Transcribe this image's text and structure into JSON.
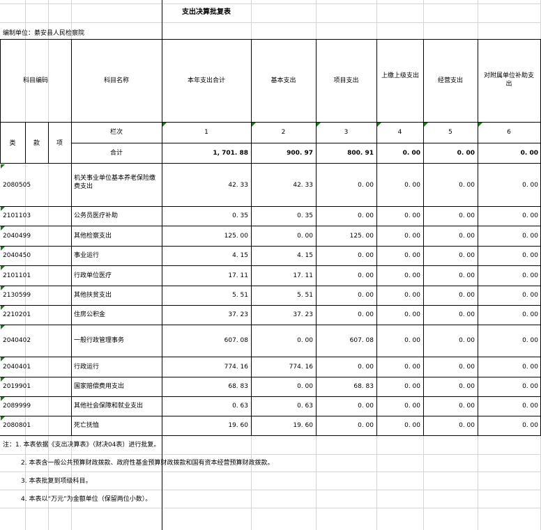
{
  "title": "支出决算批复表",
  "unit_label": "编制单位：綦安县人民检察院",
  "header": {
    "subject_code": "科目编码",
    "subject_name": "科目名称",
    "cols": [
      "本年支出合计",
      "基本支出",
      "项目支出",
      "上缴上级支出",
      "经营支出",
      "对附属单位补助支出"
    ],
    "lei": "类",
    "kuan": "款",
    "xiang": "项",
    "row_label": "栏次",
    "col_nums": [
      "1",
      "2",
      "3",
      "4",
      "5",
      "6"
    ],
    "total_label": "合计",
    "totals": [
      "1, 701. 88",
      "900. 97",
      "800. 91",
      "0. 00",
      "0. 00",
      "0. 00"
    ]
  },
  "rows": [
    {
      "code": "2080505",
      "name": "机关事业单位基本养老保险缴费支出",
      "v": [
        "42. 33",
        "42. 33",
        "0. 00",
        "0. 00",
        "0. 00",
        "0. 00"
      ]
    },
    {
      "code": "2101103",
      "name": "公务员医疗补助",
      "v": [
        "0. 35",
        "0. 35",
        "0. 00",
        "0. 00",
        "0. 00",
        "0. 00"
      ]
    },
    {
      "code": "2040499",
      "name": "其他检察支出",
      "v": [
        "125. 00",
        "0. 00",
        "125. 00",
        "0. 00",
        "0. 00",
        "0. 00"
      ]
    },
    {
      "code": "2040450",
      "name": "事业运行",
      "v": [
        "4. 15",
        "4. 15",
        "0. 00",
        "0. 00",
        "0. 00",
        "0. 00"
      ]
    },
    {
      "code": "2101101",
      "name": "行政单位医疗",
      "v": [
        "17. 11",
        "17. 11",
        "0. 00",
        "0. 00",
        "0. 00",
        "0. 00"
      ]
    },
    {
      "code": "2130599",
      "name": "其他扶贫支出",
      "v": [
        "5. 51",
        "5. 51",
        "0. 00",
        "0. 00",
        "0. 00",
        "0. 00"
      ]
    },
    {
      "code": "2210201",
      "name": "住房公积金",
      "v": [
        "37. 23",
        "37. 23",
        "0. 00",
        "0. 00",
        "0. 00",
        "0. 00"
      ]
    },
    {
      "code": "2040402",
      "name": "一般行政管理事务",
      "v": [
        "607. 08",
        "0. 00",
        "607. 08",
        "0. 00",
        "0. 00",
        "0. 00"
      ]
    },
    {
      "code": "2040401",
      "name": "行政运行",
      "v": [
        "774. 16",
        "774. 16",
        "0. 00",
        "0. 00",
        "0. 00",
        "0. 00"
      ]
    },
    {
      "code": "2019901",
      "name": "国家赔偿费用支出",
      "v": [
        "68. 83",
        "0. 00",
        "68. 83",
        "0. 00",
        "0. 00",
        "0. 00"
      ]
    },
    {
      "code": "2089999",
      "name": "其他社会保障和就业支出",
      "v": [
        "0. 63",
        "0. 63",
        "0. 00",
        "0. 00",
        "0. 00",
        "0. 00"
      ]
    },
    {
      "code": "2080801",
      "name": "死亡抚恤",
      "v": [
        "19. 60",
        "19. 60",
        "0. 00",
        "0. 00",
        "0. 00",
        "0. 00"
      ]
    }
  ],
  "notes": [
    "注：1. 本表依据《支出决算表》（财决04表）进行批复。",
    "2. 本表含一般公共预算财政拨款、政府性基金预算财政拨款和国有资本经营预算财政拨款。",
    "3. 本表批复到项级科目。",
    "4. 本表以“万元”为金额单位（保留两位小数）。"
  ]
}
